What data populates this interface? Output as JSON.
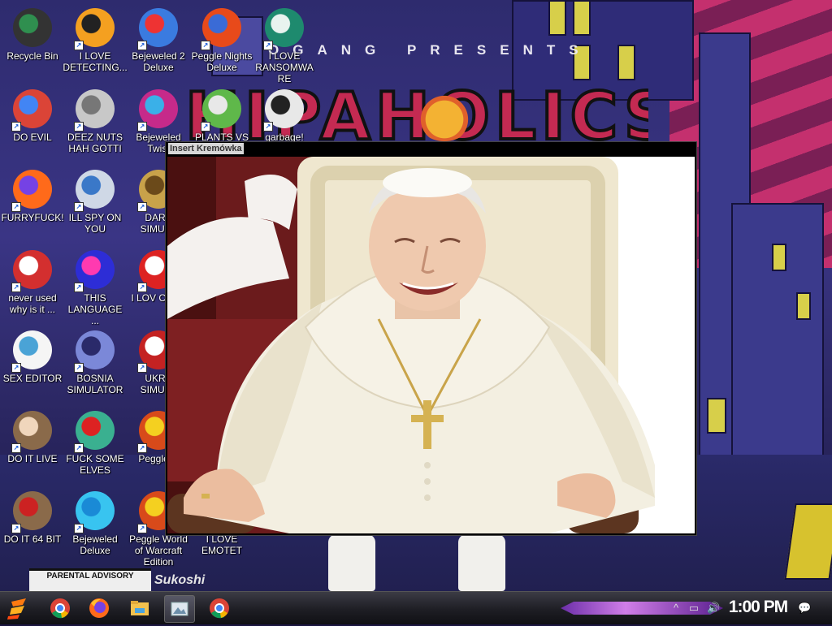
{
  "wallpaper": {
    "banner_text": "OGANG  PRESENTS",
    "logo_text": "HIPAHOLICS",
    "advisory_text": "PARENTAL ADVISORY",
    "sign_text": "Sukoshi"
  },
  "viewer": {
    "title": "Insert Kremówka"
  },
  "desktop_icons": [
    {
      "label": "Recycle Bin",
      "icon": "recycle-bin-icon",
      "shortcut": false
    },
    {
      "label": "I LOVE DETECTING...",
      "icon": "detect-it-easy-icon",
      "shortcut": true
    },
    {
      "label": "Bejeweled 2 Deluxe",
      "icon": "bejeweled-2-icon",
      "shortcut": true
    },
    {
      "label": "Peggle Nights Deluxe",
      "icon": "peggle-nights-icon",
      "shortcut": true
    },
    {
      "label": "I LOVE RANSOMWARE",
      "icon": "publisher-icon",
      "shortcut": true
    },
    {
      "label": "DO EVIL",
      "icon": "chrome-icon",
      "shortcut": true
    },
    {
      "label": "DEEZ NUTS HAH GOTTI",
      "icon": "window-stack-icon",
      "shortcut": true
    },
    {
      "label": "Bejeweled Twist",
      "icon": "bejeweled-twist-icon",
      "shortcut": true
    },
    {
      "label": "PLANTS VS",
      "icon": "plants-vs-zombies-icon",
      "shortcut": true
    },
    {
      "label": "garbage!",
      "icon": "splat-icon",
      "shortcut": true
    },
    {
      "label": "FURRYFUCK!",
      "icon": "firefox-icon",
      "shortcut": true
    },
    {
      "label": "ILL SPY ON YOU",
      "icon": "spy-tool-icon",
      "shortcut": true
    },
    {
      "label": "DARK SIMULA",
      "icon": "money-bag-icon",
      "shortcut": true
    },
    {
      "label": "never used why is it ...",
      "icon": "dev-cpp-icon",
      "shortcut": true
    },
    {
      "label": "THIS LANGUAGE ...",
      "icon": "goland-icon",
      "shortcut": true
    },
    {
      "label": "I LOV CHUZ",
      "icon": "red-blob-icon",
      "shortcut": true
    },
    {
      "label": "SEX EDITOR",
      "icon": "hxd-icon",
      "shortcut": true
    },
    {
      "label": "BOSNIA SIMULATOR",
      "icon": "minesweeper-icon",
      "shortcut": true
    },
    {
      "label": "UKRA SIMULA",
      "icon": "radiation-icon",
      "shortcut": true
    },
    {
      "label": "DO IT LIVE",
      "icon": "portrait-icon",
      "shortcut": true
    },
    {
      "label": "FUCK SOME ELVES",
      "icon": "santa-icon",
      "shortcut": true
    },
    {
      "label": "Peggle D",
      "icon": "peggle-icon",
      "shortcut": true
    },
    {
      "label": "DO IT 64 BIT",
      "icon": "portrait-64-icon",
      "shortcut": true
    },
    {
      "label": "Bejeweled Deluxe",
      "icon": "diamond-icon",
      "shortcut": true
    },
    {
      "label": "Peggle World of Warcraft Edition",
      "icon": "peggle-wow-icon",
      "shortcut": true
    },
    {
      "label": "I LOVE EMOTET",
      "icon": "emotet-icon",
      "shortcut": false
    }
  ],
  "taskbar": {
    "start_icon": "start-logo-icon",
    "pinned": [
      {
        "name": "chrome-icon"
      },
      {
        "name": "firefox-icon"
      },
      {
        "name": "file-explorer-icon"
      },
      {
        "name": "photo-viewer-icon"
      },
      {
        "name": "chrome-icon"
      }
    ],
    "tray": {
      "chevron": "^",
      "network": "▭",
      "volume": "🔊",
      "clock": "1:00 PM",
      "notifications": "💬"
    }
  },
  "colors": {
    "taskbar": "#1e1e24",
    "wallpaper_sky": "#c4306e",
    "logo_red": "#c42a52"
  }
}
